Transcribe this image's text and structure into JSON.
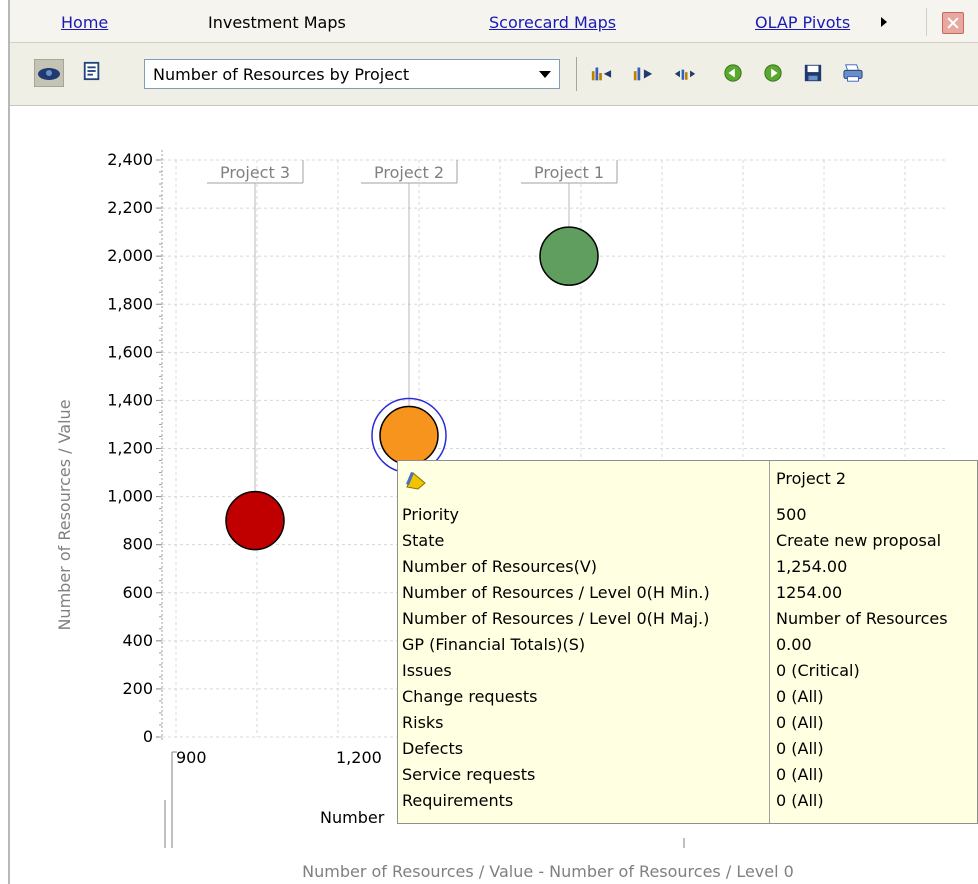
{
  "tabs": {
    "home": "Home",
    "investment_maps": "Investment Maps",
    "scorecard_maps": "Scorecard Maps",
    "olap_pivots": "OLAP Pivots"
  },
  "toolbar": {
    "map_select_value": "Number of Resources by Project"
  },
  "chart_data": {
    "type": "scatter",
    "title": "",
    "ylabel": "Number of Resources / Value",
    "xlabel": "Number of Resources / Value - Number of Resources / Level 0",
    "x_ticks": [
      "900",
      "1,200"
    ],
    "y_ticks": [
      "0",
      "200",
      "400",
      "600",
      "800",
      "1,000",
      "1,200",
      "1,400",
      "1,600",
      "1,800",
      "2,000",
      "2,200",
      "2,400"
    ],
    "ylim": [
      0,
      2400
    ],
    "grid": true,
    "points": [
      {
        "label": "Project 3",
        "y": 900,
        "color": "#c00000"
      },
      {
        "label": "Project 2",
        "y": 1254,
        "color": "#f7941d",
        "selected": true
      },
      {
        "label": "Project 1",
        "y": 2000,
        "color": "#5f9e5f"
      }
    ],
    "partial_axis_text": "Number"
  },
  "tooltip": {
    "title": "Project 2",
    "rows": [
      {
        "label": "Priority",
        "value": "500"
      },
      {
        "label": "State",
        "value": "Create new proposal"
      },
      {
        "label": "Number of Resources(V)",
        "value": "1,254.00"
      },
      {
        "label": "Number of Resources / Level 0(H Min.)",
        "value": "1254.00"
      },
      {
        "label": "Number of Resources / Level 0(H Maj.)",
        "value": "Number of Resources"
      },
      {
        "label": "GP (Financial Totals)(S)",
        "value": "0.00"
      },
      {
        "label": "Issues",
        "value": "0 (Critical)"
      },
      {
        "label": "Change requests",
        "value": "0 (All)"
      },
      {
        "label": "Risks",
        "value": "0 (All)"
      },
      {
        "label": "Defects",
        "value": "0 (All)"
      },
      {
        "label": "Service requests",
        "value": "0 (All)"
      },
      {
        "label": "Requirements",
        "value": "0 (All)"
      }
    ]
  },
  "colors": {
    "link": "#1a1ab5",
    "tooltip_bg": "#ffffe1",
    "project3": "#c00000",
    "project2": "#f7941d",
    "project1": "#5f9e5f",
    "selection_ring": "#2b2bd6"
  }
}
